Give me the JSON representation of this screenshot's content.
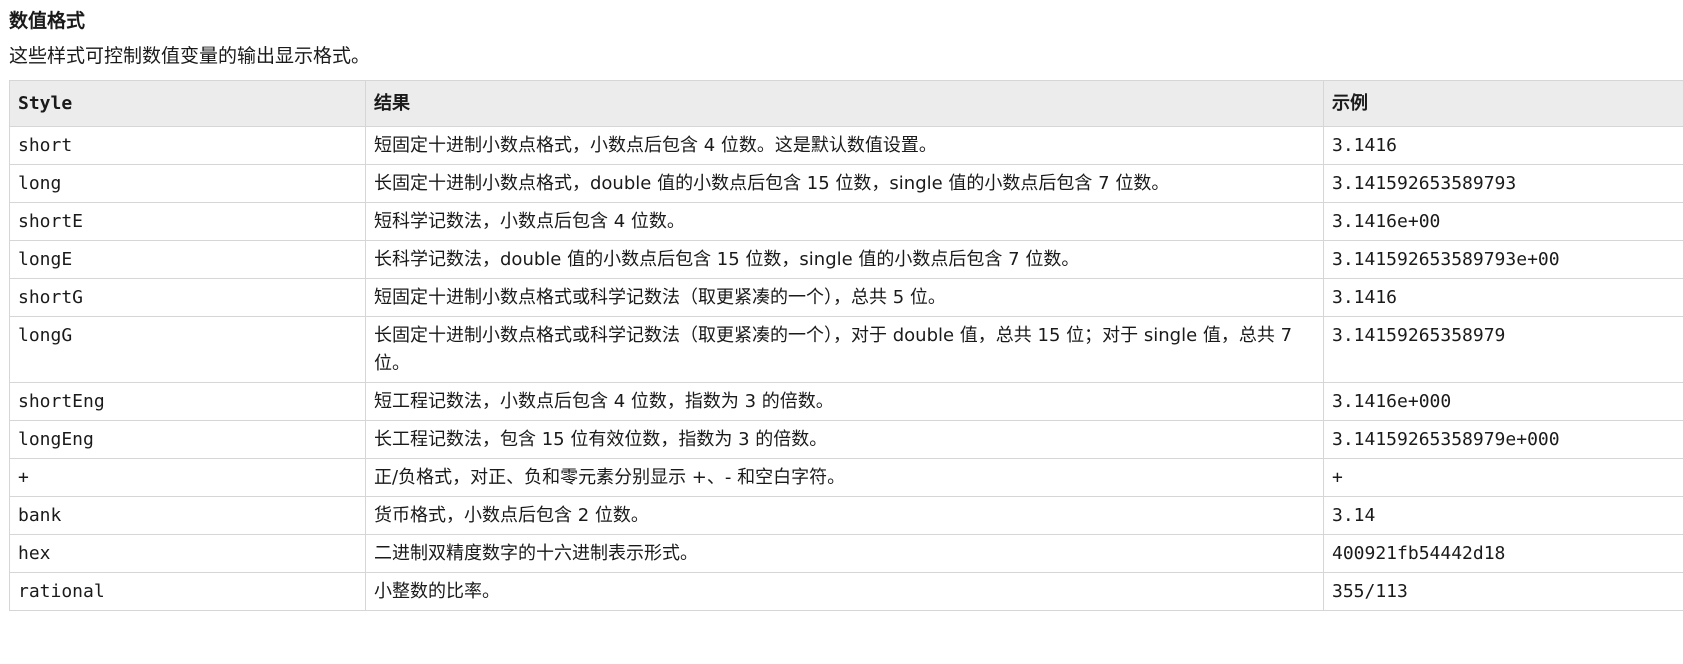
{
  "section": {
    "title": "数值格式",
    "description": "这些样式可控制数值变量的输出显示格式。"
  },
  "table": {
    "headers": {
      "style": "Style",
      "result": "结果",
      "example": "示例"
    },
    "rows": [
      {
        "style": "short",
        "result": "短固定十进制小数点格式，小数点后包含 4 位数。这是默认数值设置。",
        "example": "3.1416"
      },
      {
        "style": "long",
        "result": "长固定十进制小数点格式，double 值的小数点后包含 15 位数，single 值的小数点后包含 7 位数。",
        "example": "3.141592653589793"
      },
      {
        "style": "shortE",
        "result": "短科学记数法，小数点后包含 4 位数。",
        "example": "3.1416e+00"
      },
      {
        "style": "longE",
        "result": "长科学记数法，double 值的小数点后包含 15 位数，single 值的小数点后包含 7 位数。",
        "example": "3.141592653589793e+00"
      },
      {
        "style": "shortG",
        "result": "短固定十进制小数点格式或科学记数法（取更紧凑的一个），总共 5 位。",
        "example": "3.1416"
      },
      {
        "style": "longG",
        "result": "长固定十进制小数点格式或科学记数法（取更紧凑的一个），对于 double 值，总共 15 位；对于 single 值，总共 7 位。",
        "example": "3.14159265358979"
      },
      {
        "style": "shortEng",
        "result": "短工程记数法，小数点后包含 4 位数，指数为 3 的倍数。",
        "example": "3.1416e+000"
      },
      {
        "style": "longEng",
        "result": "长工程记数法，包含 15 位有效位数，指数为 3 的倍数。",
        "example": "3.14159265358979e+000"
      },
      {
        "style": "+",
        "result": "正/负格式，对正、负和零元素分别显示 +、- 和空白字符。",
        "example": "+"
      },
      {
        "style": "bank",
        "result": "货币格式，小数点后包含 2 位数。",
        "example": "3.14"
      },
      {
        "style": "hex",
        "result": "二进制双精度数字的十六进制表示形式。",
        "example": "400921fb54442d18"
      },
      {
        "style": "rational",
        "result": "小整数的比率。",
        "example": "355/113"
      }
    ]
  }
}
